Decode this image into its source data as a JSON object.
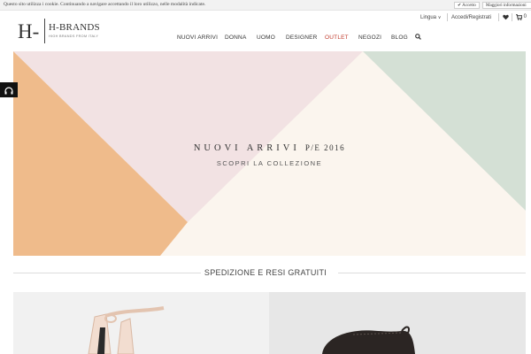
{
  "cookie_bar": {
    "text": "Questo sito utilizza i cookie. Continuando a navigare accettando il loro utilizzo, nelle modalità indicate.",
    "accept_label": "✔ Accetto",
    "more_label": "Maggiori informazioni"
  },
  "logo": {
    "mark": "H-",
    "name": "H-BRANDS",
    "tagline": "HIGH BRANDS FROM ITALY"
  },
  "utility_nav": {
    "language_label": "Lingua",
    "account_label": "Accedi/Registrati",
    "cart_count": "0"
  },
  "main_nav": {
    "items": [
      "NUOVI ARRIVI",
      "DONNA",
      "UOMO",
      "DESIGNER",
      "OUTLET",
      "NEGOZI",
      "BLOG"
    ]
  },
  "hero": {
    "title": "NUOVI ARRIVI",
    "season": "P/E 2016",
    "subtitle": "SCOPRI LA COLLEZIONE",
    "colors": {
      "peach": "#EFBB8B",
      "pink": "#F2E2E3",
      "mint": "#D4E0D5",
      "cream": "#FBF5EE"
    }
  },
  "shipping": {
    "text": "SPEDIZIONE E RESI GRATUITI"
  },
  "colors": {
    "accent_outlet": "#C0392B",
    "side_tab": "#111111"
  }
}
